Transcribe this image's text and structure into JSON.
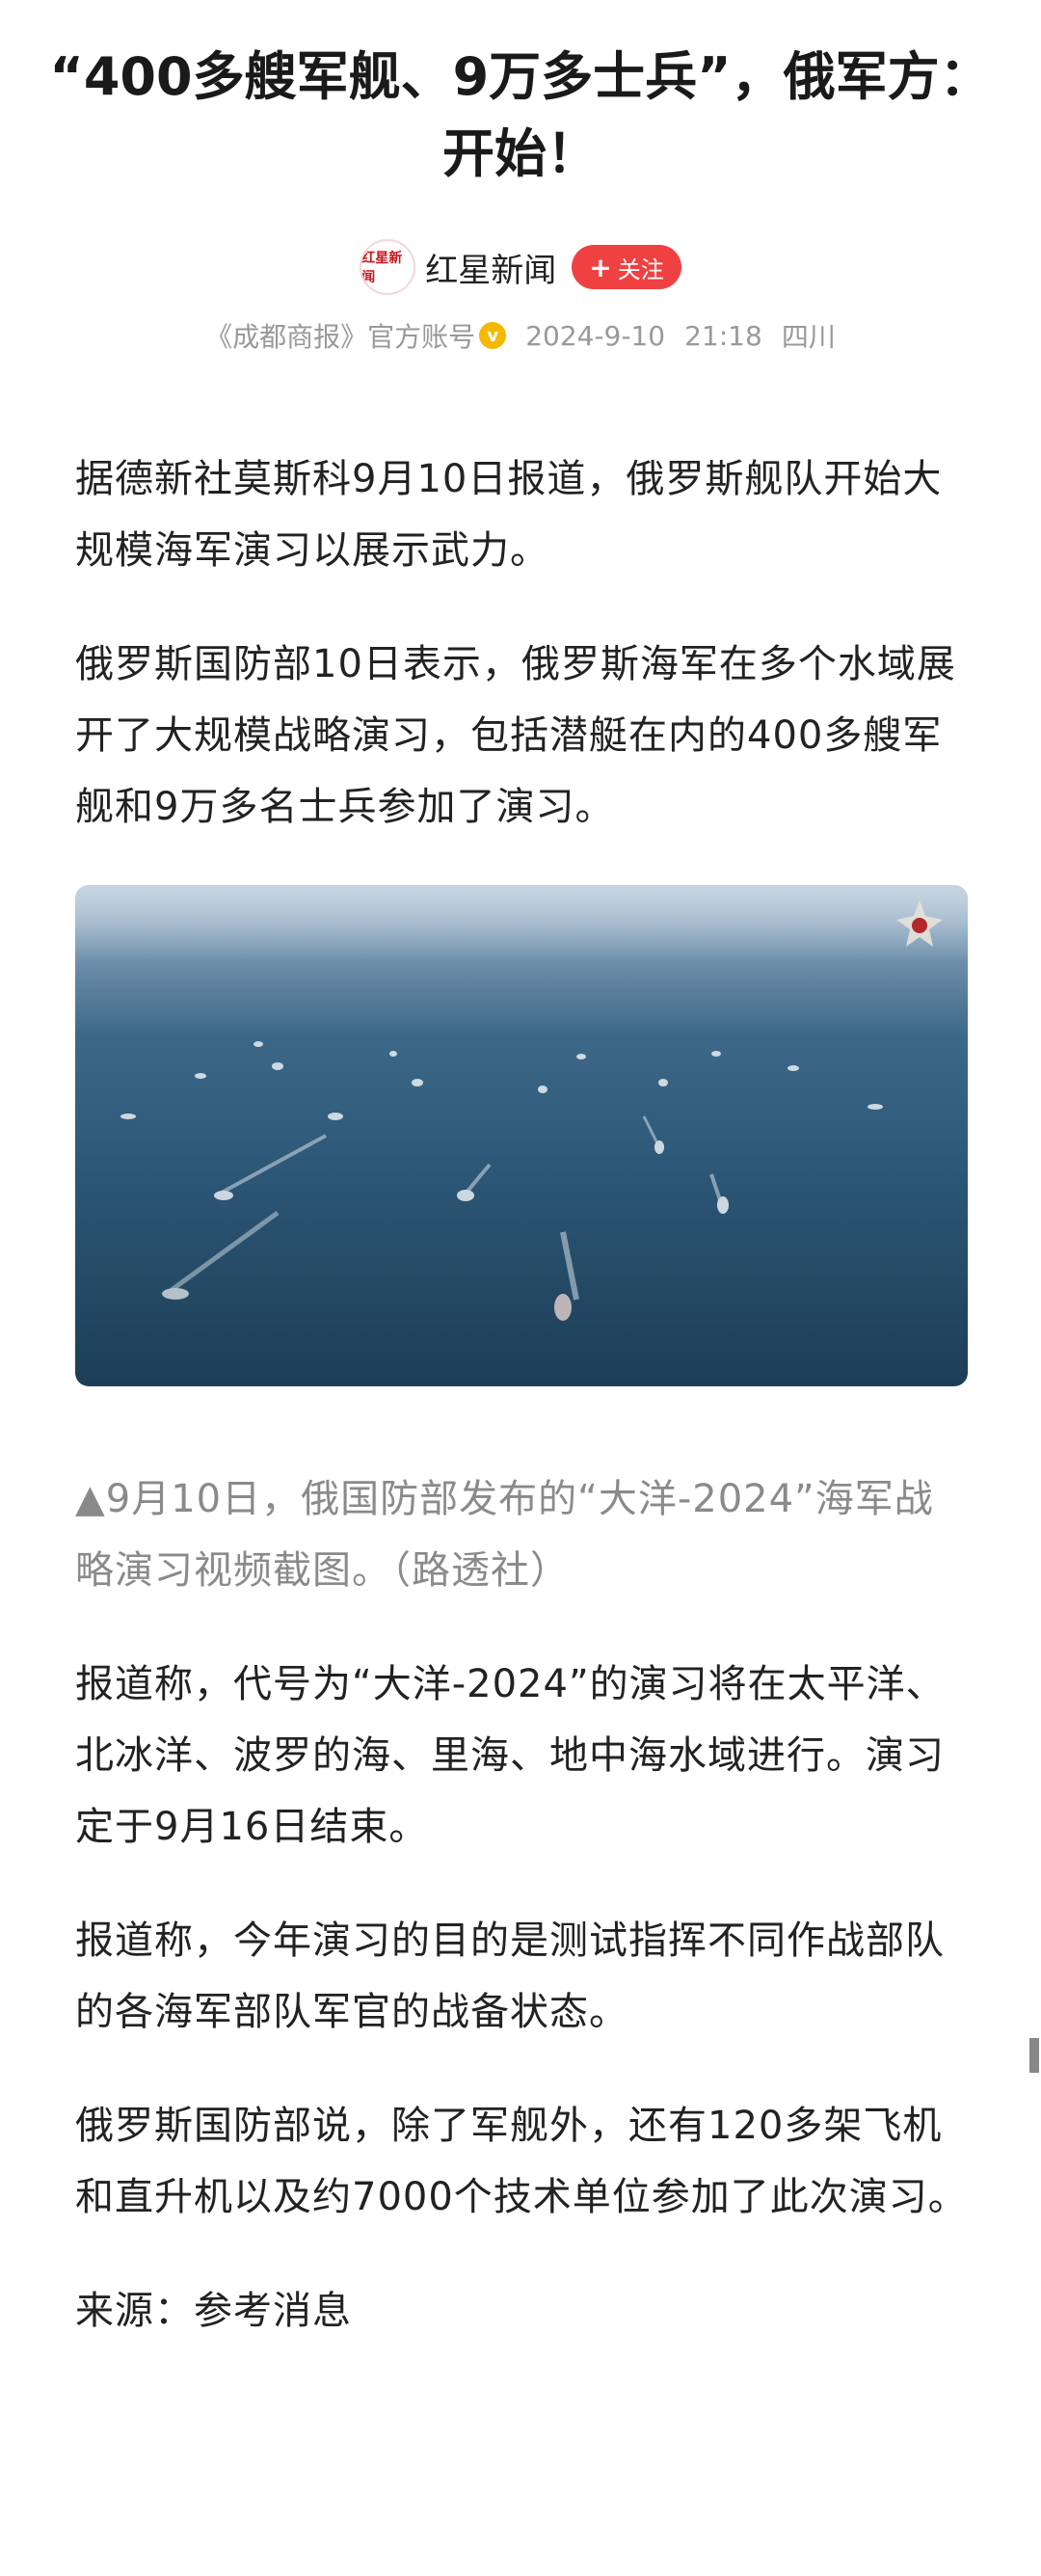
{
  "article": {
    "title": "“400多艘军舰、9万多士兵”，俄军方：开始！",
    "author": {
      "avatar_text": "红星新闻",
      "name": "红星新闻",
      "follow_label": "关注",
      "follow_icon": "plus-icon"
    },
    "meta": {
      "source": "《成都商报》官方账号",
      "verified_icon": "verified-badge-icon",
      "date": "2024-9-10",
      "time": "21:18",
      "location": "四川"
    },
    "paragraphs_before_image": [
      "据德新社莫斯科9月10日报道，俄罗斯舰队开始大规模海军演习以展示武力。",
      "俄罗斯国防部10日表示，俄罗斯海军在多个水域展开了大规模战略演习，包括潜艇在内的400多艘军舰和9万多名士兵参加了演习。"
    ],
    "image": {
      "emblem_icon": "russian-defense-ministry-emblem-icon",
      "caption": "▲9月10日，俄国防部发布的“大洋-2024”海军战略演习视频截图。（路透社）"
    },
    "paragraphs_after_image": [
      "报道称，代号为“大洋-2024”的演习将在太平洋、北冰洋、波罗的海、里海、地中海水域进行。演习定于9月16日结束。",
      "报道称，今年演习的目的是测试指挥不同作战部队的各海军部队军官的战备状态。",
      "俄罗斯国防部说，除了军舰外，还有120多架飞机和直升机以及约7000个技术单位参加了此次演习。",
      "来源：参考消息"
    ]
  },
  "colors": {
    "follow_button": "#f04142",
    "meta_text": "#999999",
    "caption_text": "#8a8a8a",
    "body_text": "#222222"
  }
}
